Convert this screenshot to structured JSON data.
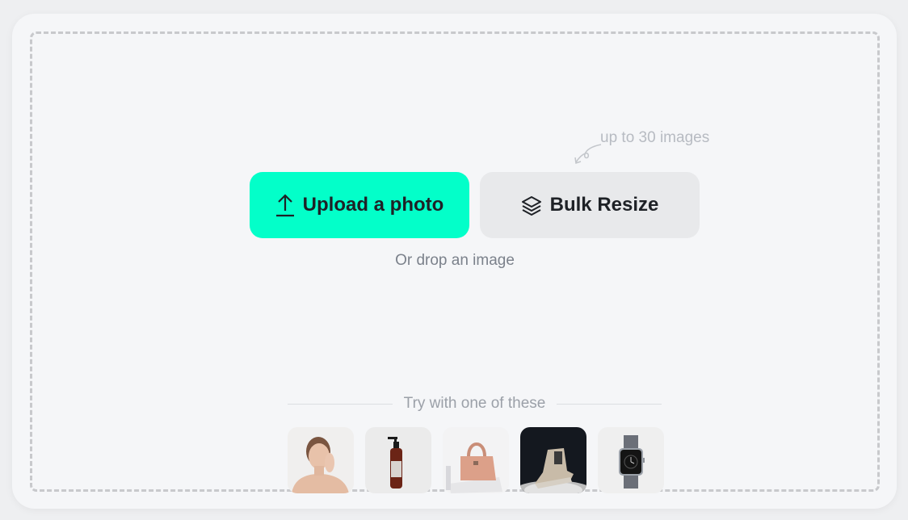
{
  "hint": {
    "text": "up to 30 images"
  },
  "buttons": {
    "upload": {
      "label": "Upload a photo",
      "icon": "upload-icon",
      "color": "#03ffc9"
    },
    "bulk": {
      "label": "Bulk Resize",
      "icon": "layers-icon",
      "color": "#e8e9eb"
    }
  },
  "drop_text": "Or drop an image",
  "samples": {
    "heading": "Try with one of these",
    "items": [
      {
        "name": "woman-portrait",
        "background": "#f0efee"
      },
      {
        "name": "lotion-bottle",
        "background": "#ebebeb"
      },
      {
        "name": "pink-handbag",
        "background": "#f2f2f3"
      },
      {
        "name": "sneaker",
        "background": "#14181f"
      },
      {
        "name": "smartwatch",
        "background": "#efefef"
      }
    ]
  }
}
